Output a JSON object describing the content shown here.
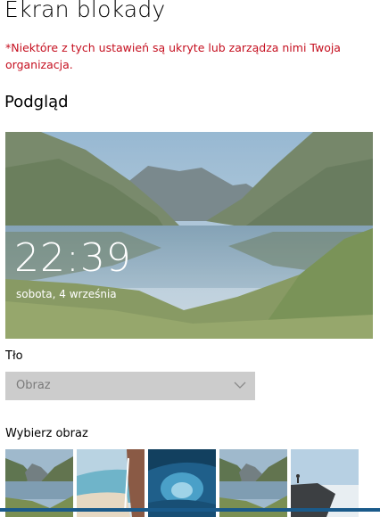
{
  "page": {
    "title": "Ekran blokady",
    "org_notice": "*Niektóre z tych ustawień są ukryte lub zarządza nimi Twoja organizacja."
  },
  "preview": {
    "heading": "Podgląd",
    "time": "22:39",
    "date": "sobota, 4 września"
  },
  "background": {
    "label": "Tło",
    "selected": "Obraz",
    "chevron_icon": "chevron-down-icon"
  },
  "choose_image": {
    "label": "Wybierz obraz",
    "thumbnails": [
      "mountain-lake-image",
      "rock-arch-beach-image",
      "ice-cave-image",
      "mountain-lake-image",
      "hiker-cliff-image"
    ]
  },
  "colors": {
    "notice": "#c50f1f",
    "dropdown_bg": "#cccccc",
    "dropdown_text": "#7a7a7a",
    "accent_bar": "#1a5a8a"
  }
}
